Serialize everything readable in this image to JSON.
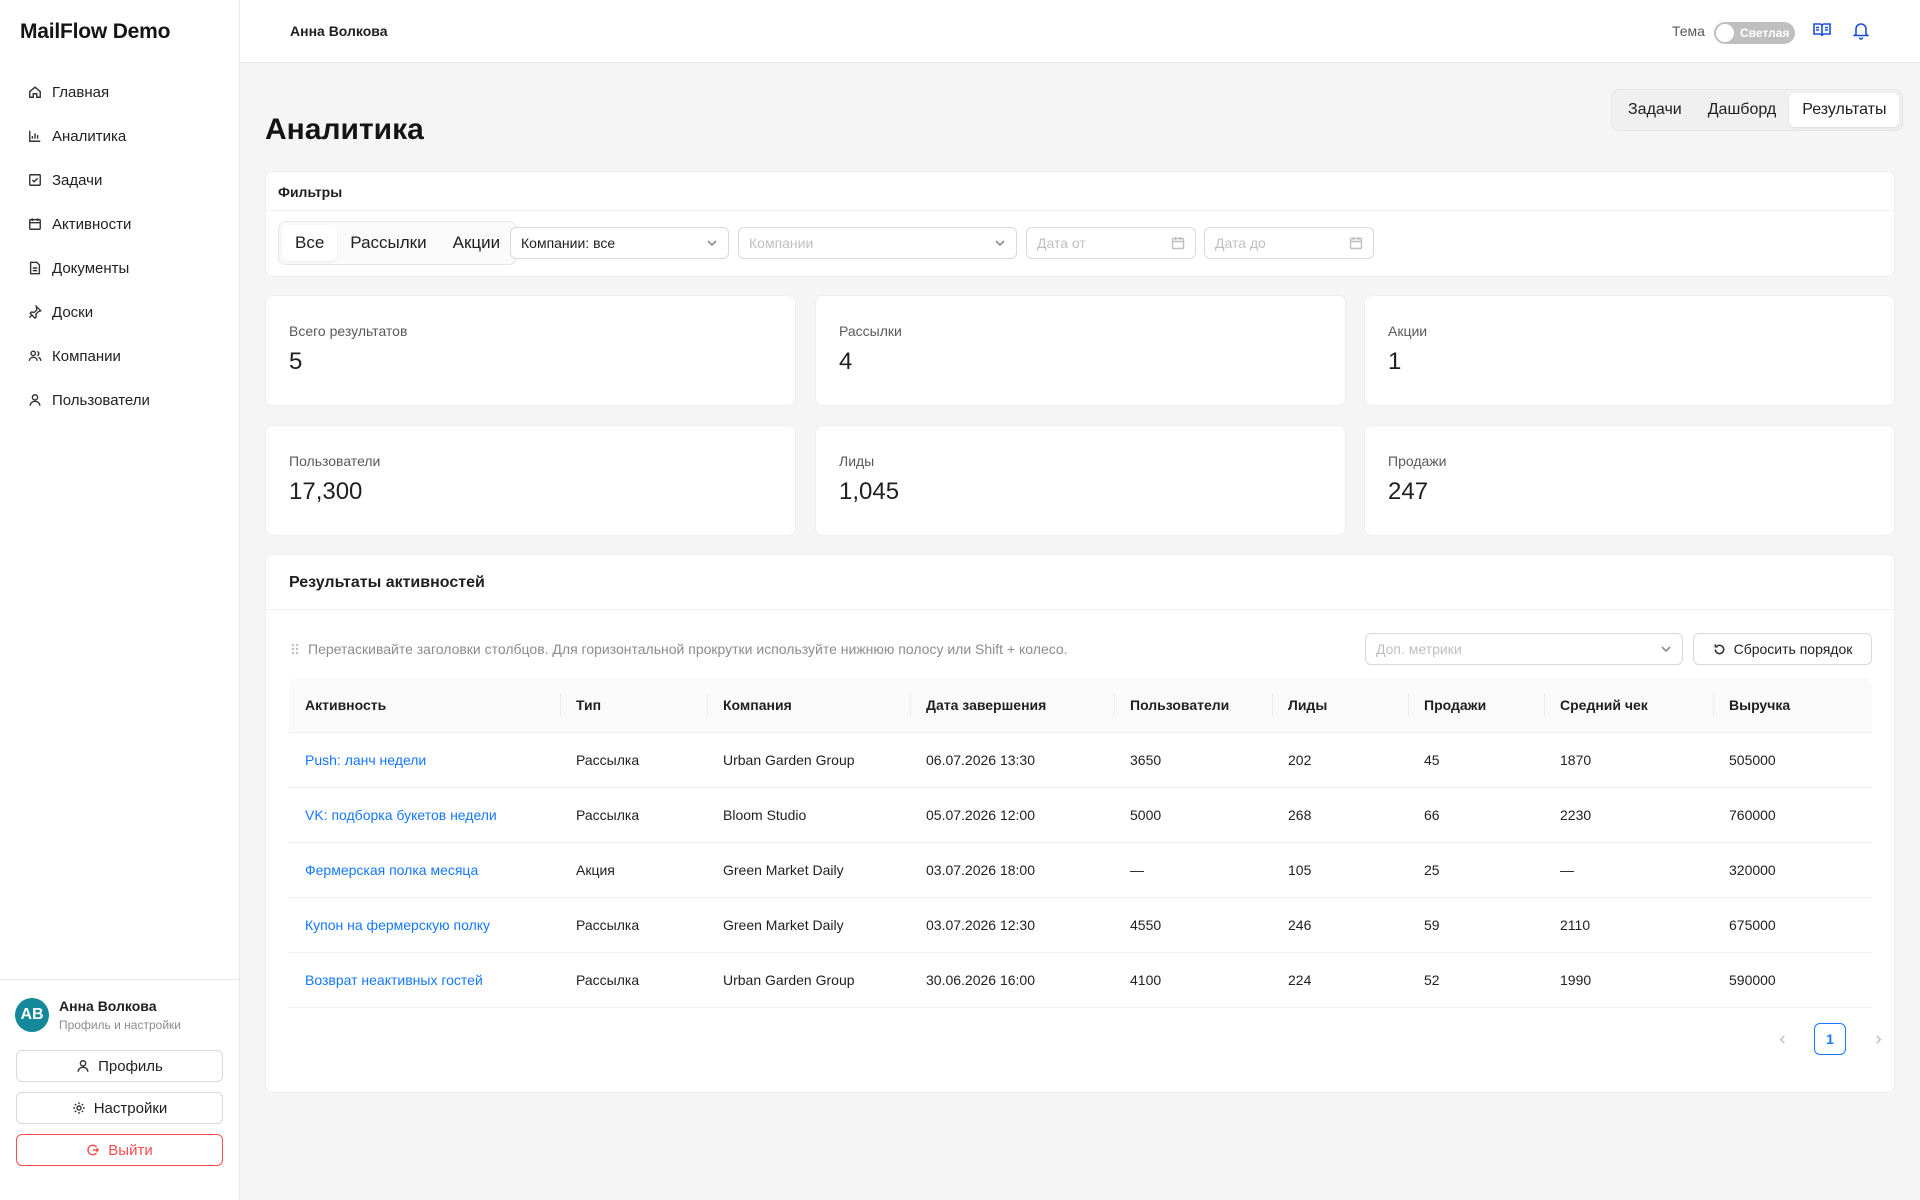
{
  "app": {
    "brand": "MailFlow Demo"
  },
  "sidebar": {
    "items": [
      {
        "label": "Главная",
        "icon": "home-icon"
      },
      {
        "label": "Аналитика",
        "icon": "chart-icon"
      },
      {
        "label": "Задачи",
        "icon": "checkbox-icon"
      },
      {
        "label": "Активности",
        "icon": "calendar-icon"
      },
      {
        "label": "Документы",
        "icon": "document-icon"
      },
      {
        "label": "Доски",
        "icon": "pin-icon"
      },
      {
        "label": "Компании",
        "icon": "companies-icon"
      },
      {
        "label": "Пользователи",
        "icon": "user-icon"
      }
    ],
    "user": {
      "initials": "AB",
      "name": "Анна Волкова",
      "subtitle": "Профиль и настройки"
    },
    "profile_label": "Профиль",
    "settings_label": "Настройки",
    "logout_label": "Выйти"
  },
  "header": {
    "user_name": "Анна Волкова",
    "theme_label": "Тема",
    "theme_value": "Светлая",
    "accent": "#1d4fd6"
  },
  "page": {
    "title": "Аналитика",
    "view_tabs": [
      "Задачи",
      "Дашборд",
      "Результаты"
    ],
    "active_view": "Результаты"
  },
  "filters": {
    "title": "Фильтры",
    "type_tabs": [
      "Все",
      "Рассылки",
      "Акции"
    ],
    "active_type": "Все",
    "company_scope": "Компании: все",
    "companies_placeholder": "Компании",
    "date_from_placeholder": "Дата от",
    "date_to_placeholder": "Дата до"
  },
  "stats": [
    {
      "label": "Всего результатов",
      "value": "5"
    },
    {
      "label": "Рассылки",
      "value": "4"
    },
    {
      "label": "Акции",
      "value": "1"
    },
    {
      "label": "Пользователи",
      "value": "17,300"
    },
    {
      "label": "Лиды",
      "value": "1,045"
    },
    {
      "label": "Продажи",
      "value": "247"
    }
  ],
  "results": {
    "title": "Результаты активностей",
    "hint": "Перетаскивайте заголовки столбцов. Для горизонтальной прокрутки используйте нижнюю полосу или Shift + колесо.",
    "metrics_placeholder": "Доп. метрики",
    "reset_label": "Сбросить порядок",
    "columns": [
      "Активность",
      "Тип",
      "Компания",
      "Дата завершения",
      "Пользователи",
      "Лиды",
      "Продажи",
      "Средний чек",
      "Выручка"
    ],
    "rows": [
      [
        "Push: ланч недели",
        "Рассылка",
        "Urban Garden Group",
        "06.07.2026 13:30",
        "3650",
        "202",
        "45",
        "1870",
        "505000"
      ],
      [
        "VK: подборка букетов недели",
        "Рассылка",
        "Bloom Studio",
        "05.07.2026 12:00",
        "5000",
        "268",
        "66",
        "2230",
        "760000"
      ],
      [
        "Фермерская полка месяца",
        "Акция",
        "Green Market Daily",
        "03.07.2026 18:00",
        "—",
        "105",
        "25",
        "—",
        "320000"
      ],
      [
        "Купон на фермерскую полку",
        "Рассылка",
        "Green Market Daily",
        "03.07.2026 12:30",
        "4550",
        "246",
        "59",
        "2110",
        "675000"
      ],
      [
        "Возврат неактивных гостей",
        "Рассылка",
        "Urban Garden Group",
        "30.06.2026 16:00",
        "4100",
        "224",
        "52",
        "1990",
        "590000"
      ]
    ],
    "current_page": "1"
  }
}
